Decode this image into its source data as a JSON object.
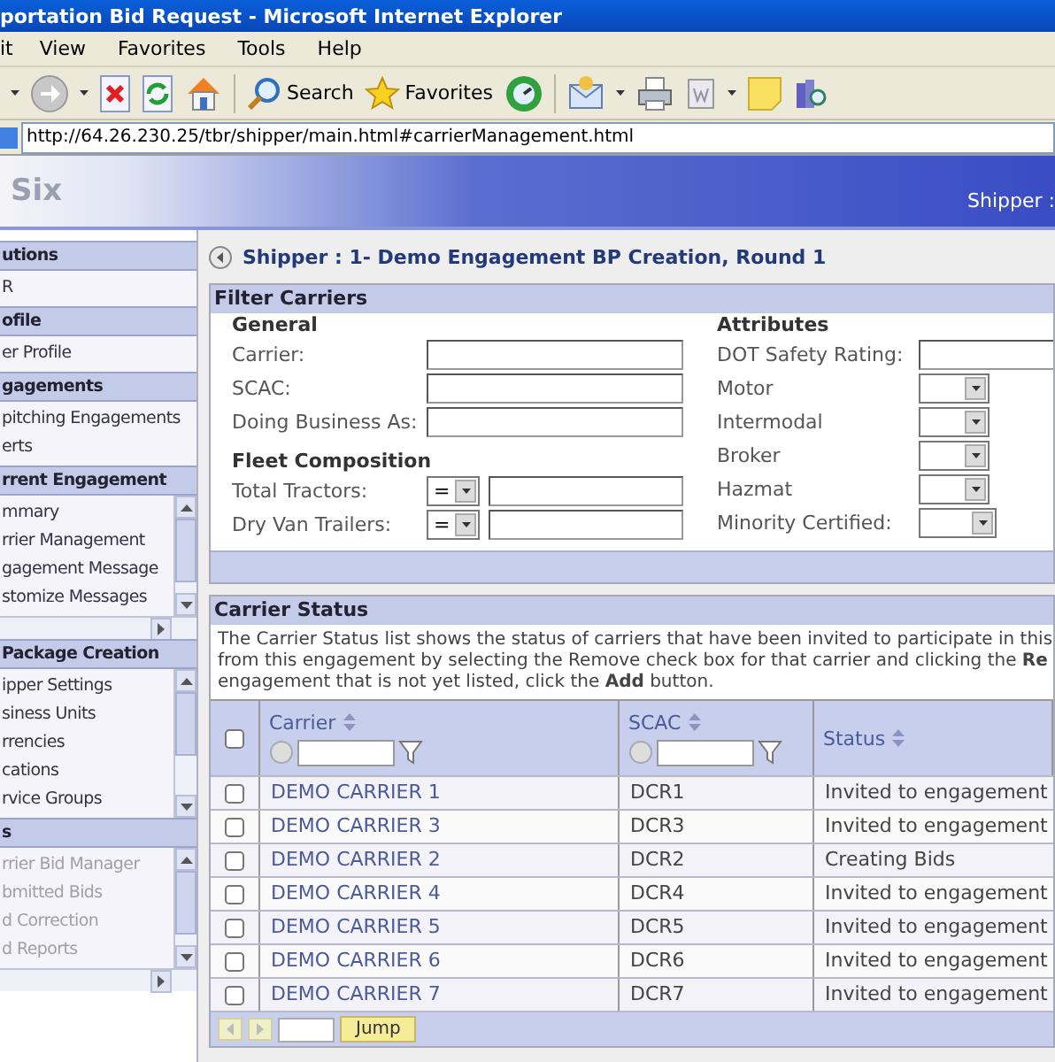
{
  "window": {
    "title": "portation Bid Request - Microsoft Internet Explorer"
  },
  "menu": [
    "it",
    "View",
    "Favorites",
    "Tools",
    "Help"
  ],
  "toolbar": {
    "search": "Search",
    "favorites": "Favorites"
  },
  "address": {
    "value": "http://64.26.230.25/tbr/shipper/main.html#carrierManagement.html"
  },
  "banner": {
    "brand": "Six",
    "user": "Shipper :"
  },
  "sidebar": [
    {
      "title": "utions",
      "kind": "plain",
      "items": [
        {
          "label": "R",
          "disabled": false
        }
      ]
    },
    {
      "title": "ofile",
      "kind": "plain",
      "items": [
        {
          "label": "er Profile",
          "disabled": false
        }
      ]
    },
    {
      "title": "gagements",
      "kind": "plain",
      "items": [
        {
          "label": "pitching Engagements",
          "disabled": false
        },
        {
          "label": "erts",
          "disabled": false
        }
      ]
    },
    {
      "title": "rrent Engagement",
      "kind": "scrolling",
      "items": [
        {
          "label": "mmary",
          "disabled": false
        },
        {
          "label": "rrier Management",
          "disabled": false
        },
        {
          "label": "gagement Message",
          "disabled": false
        },
        {
          "label": "stomize Messages",
          "disabled": false
        }
      ]
    },
    {
      "title": "Package Creation",
      "kind": "scrolling",
      "items": [
        {
          "label": "ipper Settings",
          "disabled": false
        },
        {
          "label": "siness Units",
          "disabled": false
        },
        {
          "label": "rrencies",
          "disabled": false
        },
        {
          "label": "cations",
          "disabled": false
        },
        {
          "label": "rvice Groups",
          "disabled": false
        }
      ]
    },
    {
      "title": "s",
      "kind": "scrolling",
      "items": [
        {
          "label": "rrier Bid Manager",
          "disabled": true
        },
        {
          "label": "bmitted Bids",
          "disabled": true
        },
        {
          "label": "d Correction",
          "disabled": true
        },
        {
          "label": "d Reports",
          "disabled": true
        }
      ]
    }
  ],
  "breadcrumb": "Shipper : 1- Demo Engagement BP Creation, Round 1",
  "filter": {
    "title": "Filter Carriers",
    "general": {
      "heading": "General",
      "fields": [
        {
          "label": "Carrier:"
        },
        {
          "label": "SCAC:"
        },
        {
          "label": "Doing Business As:"
        }
      ]
    },
    "fleet": {
      "heading": "Fleet Composition",
      "fields": [
        {
          "label": "Total Tractors:",
          "operator": "="
        },
        {
          "label": "Dry Van Trailers:",
          "operator": "="
        }
      ]
    },
    "attributes": {
      "heading": "Attributes",
      "fields": [
        {
          "label": "DOT Safety Rating:",
          "kind": "text"
        },
        {
          "label": "Motor",
          "kind": "select"
        },
        {
          "label": "Intermodal",
          "kind": "select"
        },
        {
          "label": "Broker",
          "kind": "select"
        },
        {
          "label": "Hazmat",
          "kind": "select"
        },
        {
          "label": "Minority Certified:",
          "kind": "wide-select"
        }
      ]
    }
  },
  "status": {
    "title": "Carrier Status",
    "description": [
      "The Carrier Status list shows the status of carriers that have been invited to participate in this",
      "from this engagement by selecting the Remove check box for that carrier and clicking the **Re**",
      "engagement that is not yet listed, click the **Add** button."
    ],
    "select_all": {
      "checked": false
    },
    "columns": [
      {
        "label": "Carrier",
        "filter": true
      },
      {
        "label": "SCAC",
        "filter": true
      },
      {
        "label": "Status",
        "filter": false
      }
    ],
    "rows": [
      {
        "carrier": "DEMO CARRIER 1",
        "scac": "DCR1",
        "status": "Invited to engagement",
        "checked": false
      },
      {
        "carrier": "DEMO CARRIER 3",
        "scac": "DCR3",
        "status": "Invited to engagement",
        "checked": false
      },
      {
        "carrier": "DEMO CARRIER 2",
        "scac": "DCR2",
        "status": "Creating Bids",
        "checked": false
      },
      {
        "carrier": "DEMO CARRIER 4",
        "scac": "DCR4",
        "status": "Invited to engagement",
        "checked": false
      },
      {
        "carrier": "DEMO CARRIER 5",
        "scac": "DCR5",
        "status": "Invited to engagement",
        "checked": false
      },
      {
        "carrier": "DEMO CARRIER 6",
        "scac": "DCR6",
        "status": "Invited to engagement",
        "checked": false
      },
      {
        "carrier": "DEMO CARRIER 7",
        "scac": "DCR7",
        "status": "Invited to engagement",
        "checked": false
      }
    ],
    "pager": {
      "jump": "Jump"
    }
  }
}
